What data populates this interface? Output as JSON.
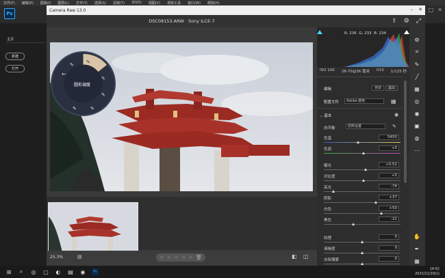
{
  "ps": {
    "menu": [
      "文件(F)",
      "编辑(E)",
      "图像(I)",
      "图层(L)",
      "文字(Y)",
      "选择(S)",
      "滤镜(T)",
      "3D(D)",
      "视图(V)",
      "增效工具",
      "窗口(W)",
      "帮助(H)"
    ],
    "logo": "Ps",
    "left_label": "主页",
    "new_button": "新建",
    "open_button": "打开"
  },
  "camera_raw": {
    "window_title": "Camera Raw 13.0",
    "filename": "DSC08153.ARW  ·  Sony ILCE-7",
    "zoom": "25.3%",
    "histogram": {
      "r": "R: 236",
      "g": "G: 233",
      "b": "B: 234"
    },
    "exif": {
      "iso": "ISO 100",
      "lens": "28-70@36 毫米",
      "aperture": "f/10",
      "shutter": "1/125 秒"
    },
    "edit_title": "编辑",
    "auto_btn": "自动",
    "bw_btn": "黑白",
    "profile_label": "配置文件",
    "profile_value": "Adobe 颜色",
    "basic_title": "基本",
    "wb_label": "白平衡",
    "wb_value": "原照设置",
    "sliders": [
      {
        "label": "色温",
        "value": "5450",
        "pos": 0.45
      },
      {
        "label": "色调",
        "value": "+5",
        "pos": 0.52
      },
      {
        "label": "曝光",
        "value": "+0.52",
        "pos": 0.55
      },
      {
        "label": "对比度",
        "value": "+5",
        "pos": 0.52
      },
      {
        "label": "高光",
        "value": "-74",
        "pos": 0.13
      },
      {
        "label": "阴影",
        "value": "+37",
        "pos": 0.68
      },
      {
        "label": "白色",
        "value": "+50",
        "pos": 0.75
      },
      {
        "label": "黑色",
        "value": "-21",
        "pos": 0.39
      },
      {
        "label": "纹理",
        "value": "0",
        "pos": 0.5
      },
      {
        "label": "清晰度",
        "value": "0",
        "pos": 0.5
      },
      {
        "label": "去除薄雾",
        "value": "0",
        "pos": 0.5
      }
    ],
    "radial_menu_label": "圆形调度"
  },
  "taskbar": {
    "time": "14:52",
    "date": "2021/11/10(1)"
  },
  "colors": {
    "accent": "#31a8ff",
    "panel": "#2d2d2d",
    "sky": "#d5d9de",
    "pagoda_red": "#9b2a22"
  }
}
